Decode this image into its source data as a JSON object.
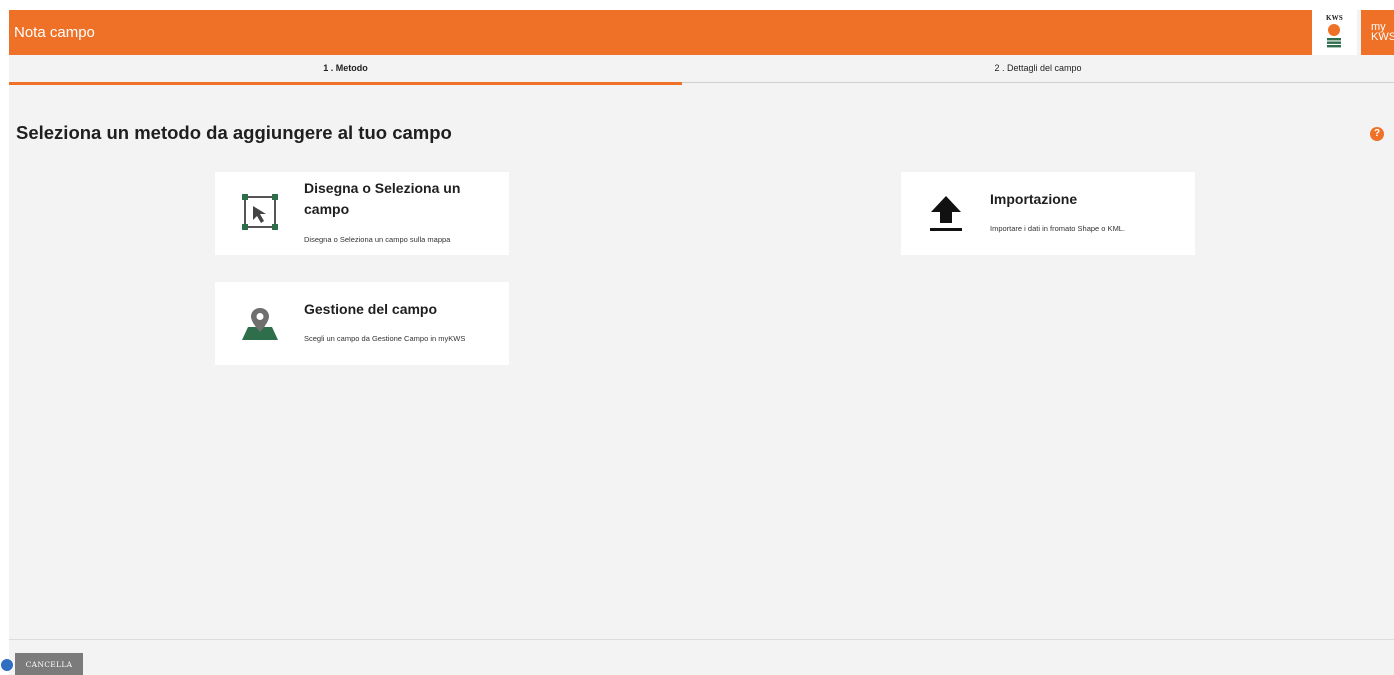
{
  "header": {
    "title": "Nota campo",
    "logo_text": "KWS",
    "my_kws_line1": "my",
    "my_kws_line2": "KWS",
    "accent_color": "#ee7127"
  },
  "tabs": [
    {
      "label": "1 . Metodo",
      "active": true
    },
    {
      "label": "2 . Dettagli del campo",
      "active": false
    }
  ],
  "main": {
    "title": "Seleziona un metodo da aggiungere al tuo campo",
    "help_symbol": "?"
  },
  "methods": [
    {
      "icon": "draw-select-field-icon",
      "title": "Disegna o Seleziona un campo",
      "description": "Disegna o Seleziona un campo sulla mappa"
    },
    {
      "icon": "upload-icon",
      "title": "Importazione",
      "description": "Importare i dati in fromato Shape o KML."
    },
    {
      "icon": "map-pin-field-icon",
      "title": "Gestione del campo",
      "description": "Scegli un campo da Gestione Campo in myKWS"
    }
  ],
  "footer": {
    "cancel_label": "CANCELLA"
  },
  "colors": {
    "brand_orange": "#ee7127",
    "icon_green": "#2e6e4a",
    "background": "#f3f3f3"
  }
}
